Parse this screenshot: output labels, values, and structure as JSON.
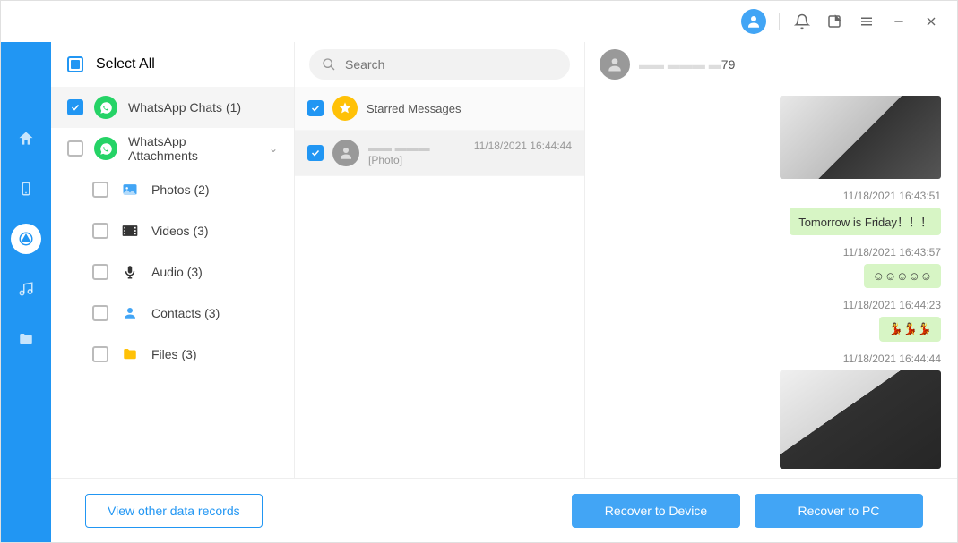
{
  "sidebar": {
    "select_all_label": "Select All",
    "items": [
      {
        "label": "WhatsApp Chats (1)",
        "checked": true
      },
      {
        "label": "WhatsApp Attachments"
      }
    ],
    "children": [
      {
        "label": "Photos (2)"
      },
      {
        "label": "Videos (3)"
      },
      {
        "label": "Audio (3)"
      },
      {
        "label": "Contacts (3)"
      },
      {
        "label": "Files (3)"
      }
    ]
  },
  "search": {
    "placeholder": "Search"
  },
  "list": {
    "starred_label": "Starred Messages",
    "chat_sub": "[Photo]",
    "chat_time": "11/18/2021 16:44:44"
  },
  "conversation": {
    "header_number_suffix": "79",
    "msgs": [
      {
        "time": "11/18/2021 16:43:51",
        "text": "Tomorrow is Friday！！！"
      },
      {
        "time": "11/18/2021 16:43:57",
        "text": "☺☺☺☺☺"
      },
      {
        "time": "11/18/2021 16:44:23",
        "text": "💃💃💃"
      },
      {
        "time": "11/18/2021 16:44:44",
        "text": ""
      }
    ]
  },
  "buttons": {
    "other_records": "View other data records",
    "recover_device": "Recover to Device",
    "recover_pc": "Recover to PC"
  }
}
